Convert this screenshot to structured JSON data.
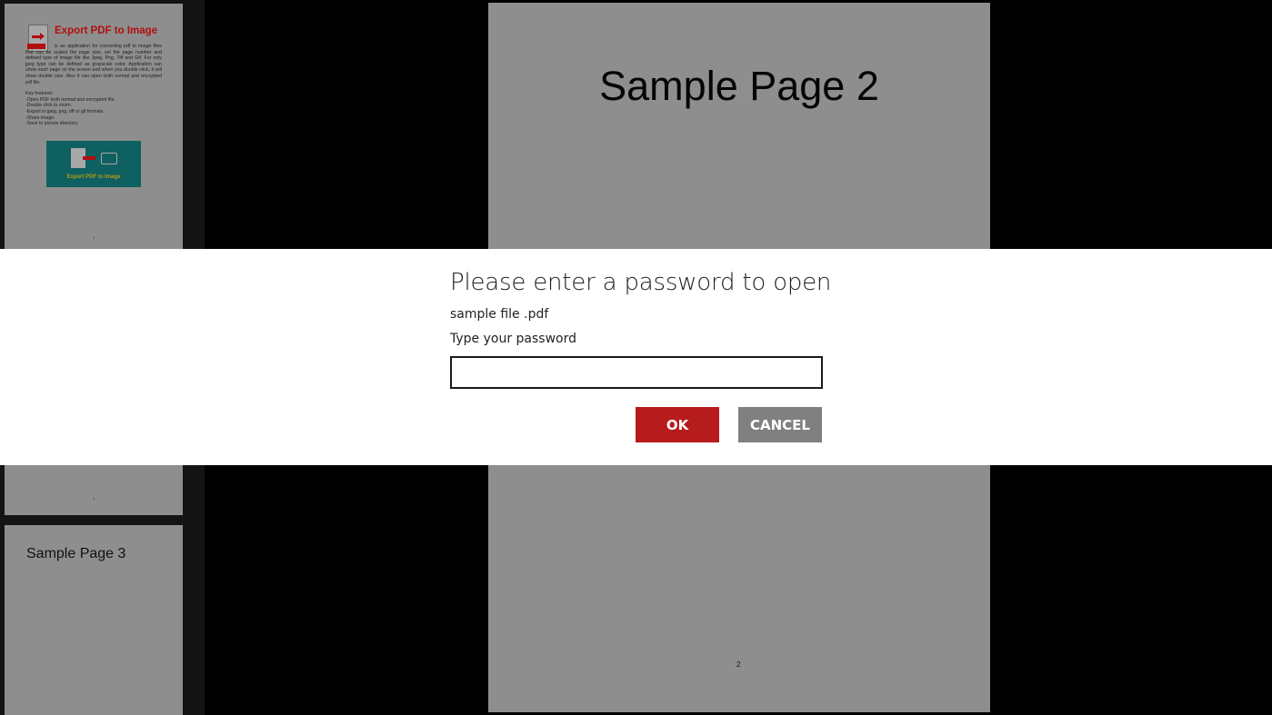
{
  "sidebar": {
    "thumbnails": [
      {
        "app_title": "Export PDF to Image",
        "app_icon": "pdf-to-image-icon",
        "description": "is an application for converting pdf to image files that can be scaled the page size, set the page number and defined type of image file like Jpeg, Png, Tiff and Gif. For only jpeg type can be defined as grayscale color. Application can show each page on the screen and when you double click, it will show double size. Also it can open both normal and encrypted pdf file.",
        "features_heading": "Key features:",
        "features": [
          "-Open PDF both normal and encrypted file",
          "-Double click to zoom.",
          "-Export to jpeg, png, tiff or gif formats.",
          "-Share image.",
          "-Save to picture directory"
        ],
        "banner_text": "Export PDF to Image",
        "page_marker_1": "1",
        "page_marker_2": "1"
      },
      {
        "title": "Sample Page 3"
      }
    ]
  },
  "page": {
    "title": "Sample Page 2",
    "number": "2"
  },
  "dialog": {
    "title": "Please enter a password to open",
    "filename": "sample file .pdf",
    "label": "Type your password",
    "input_value": "",
    "ok_label": "OK",
    "cancel_label": "CANCEL"
  },
  "colors": {
    "ok_button": "#b71c1c",
    "cancel_button": "#808080",
    "overlay_background": "#000000",
    "dialog_background": "#ffffff",
    "page_background": "#8e8e8e"
  }
}
